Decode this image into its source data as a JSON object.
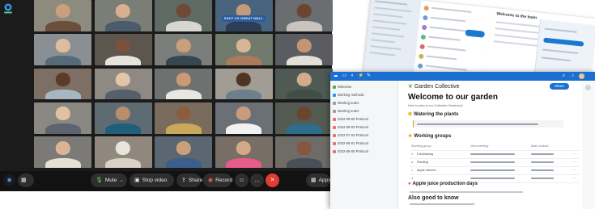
{
  "call": {
    "controls": {
      "mute": "Mute",
      "stop_video": "Stop video",
      "share": "Share",
      "record": "Record",
      "apps": "Apps"
    },
    "tiles": [
      {
        "bg": "#8d8a7e",
        "skin": "#c9a07e",
        "shirt": "#6b4f3b"
      },
      {
        "bg": "#7b7d77",
        "skin": "#d7b08e",
        "shirt": "#4b5b6a"
      },
      {
        "bg": "#5e6a63",
        "skin": "#6e4a34",
        "shirt": "#d8d6d0"
      },
      {
        "bg": "#49647e",
        "skin": "#c79a77",
        "shirt": "#2d3d55",
        "banner": "SHUT US GREAT WALL"
      },
      {
        "bg": "#6b6e70",
        "skin": "#6a4530",
        "shirt": "#c8c4bd"
      },
      {
        "bg": "#8a8f94",
        "skin": "#e0bd9c",
        "shirt": "#556b7a"
      },
      {
        "bg": "#5d564e",
        "skin": "#7a513a",
        "shirt": "#e6e3dc"
      },
      {
        "bg": "#7c7e7b",
        "skin": "#c89f7c",
        "shirt": "#37474f"
      },
      {
        "bg": "#6f7a6d",
        "skin": "#d8b594",
        "shirt": "#ab7a5a"
      },
      {
        "bg": "#5a5c62",
        "skin": "#c59474",
        "shirt": "#e2dfd8"
      },
      {
        "bg": "#7d6f63",
        "skin": "#5c3b2a",
        "shirt": "#a8b6c3"
      },
      {
        "bg": "#8e8a83",
        "skin": "#e3c4a6",
        "shirt": "#57606a"
      },
      {
        "bg": "#6d7270",
        "skin": "#c99a73",
        "shirt": "#e9e7e2"
      },
      {
        "bg": "#a19c94",
        "skin": "#4f3324",
        "shirt": "#6c7f8d"
      },
      {
        "bg": "#4f5a55",
        "skin": "#d2ab8a",
        "shirt": "#3f4f46"
      },
      {
        "bg": "#8a8883",
        "skin": "#e2c1a2",
        "shirt": "#5d6470"
      },
      {
        "bg": "#5f6b73",
        "skin": "#b98d6d",
        "shirt": "#1f5f7a"
      },
      {
        "bg": "#7a6c5d",
        "skin": "#8a5d40",
        "shirt": "#c9a85c"
      },
      {
        "bg": "#6b7076",
        "skin": "#c89c7a",
        "shirt": "#f1f1f1"
      },
      {
        "bg": "#535b52",
        "skin": "#6a462f",
        "shirt": "#2f6d8c"
      },
      {
        "bg": "#7b7a76",
        "skin": "#d9b596",
        "shirt": "#e7e1d4"
      },
      {
        "bg": "#90887c",
        "skin": "#e8e3dc",
        "shirt": "#d9d2c4"
      },
      {
        "bg": "#5a6671",
        "skin": "#caa07c",
        "shirt": "#3b5f8a"
      },
      {
        "bg": "#776e66",
        "skin": "#d4a98a",
        "shirt": "#e75c8a"
      },
      {
        "bg": "#6f6b67",
        "skin": "#845741",
        "shirt": "#4a4f58"
      }
    ]
  },
  "mail": {
    "title": "Welcome to the team"
  },
  "doc": {
    "brand": "Garden Collective",
    "share_label": "Share",
    "title": "Welcome to our garden",
    "subtitle": "Here to plan is our Collective Garden(s)!",
    "section_watering": "Watering the plants",
    "section_groups": "Working groups",
    "section_apples": "Apple juice production days",
    "section_good": "Also good to know",
    "table_headers": [
      "Working group",
      "Next meeting",
      "Main contact"
    ],
    "table_rows": [
      {
        "icon": "#e07a5f",
        "a": "Fundraising",
        "b": "",
        "c": ""
      },
      {
        "icon": "#6aa84f",
        "a": "Planting",
        "b": "",
        "c": ""
      },
      {
        "icon": "#f6b26b",
        "a": "Apple harvest",
        "b": "",
        "c": ""
      },
      {
        "icon": "#8e7cc3",
        "a": "",
        "b": "",
        "c": ""
      }
    ],
    "sidebar": [
      {
        "label": "Welcome",
        "color": "#4caf50"
      },
      {
        "label": "Working methods",
        "color": "#2196f3"
      },
      {
        "label": "Meeting notes",
        "color": "#9e9e9e"
      },
      {
        "label": "Meeting notes",
        "color": "#9e9e9e"
      },
      {
        "label": "2022-09-06 Protocol",
        "color": "#e57373"
      },
      {
        "label": "2022-08-03 Protocol",
        "color": "#e57373"
      },
      {
        "label": "2022-07-04 Protocol",
        "color": "#e57373"
      },
      {
        "label": "2022-06-01 Protocol",
        "color": "#e57373"
      },
      {
        "label": "2022-05-05 Protocol",
        "color": "#e57373"
      }
    ]
  }
}
